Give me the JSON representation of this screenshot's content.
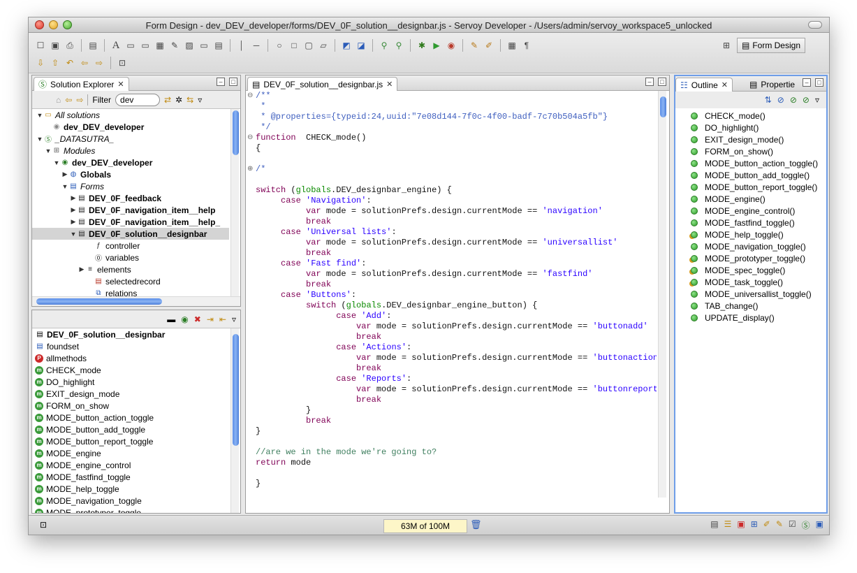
{
  "window": {
    "title": "Form Design - dev_DEV_developer/forms/DEV_0F_solution__designbar.js - Servoy Developer - /Users/admin/servoy_workspace5_unlocked"
  },
  "toolbar": {
    "perspective_label": "Form Design"
  },
  "solution_explorer": {
    "tab_label": "Solution Explorer",
    "filter_label": "Filter",
    "filter_value": "dev",
    "tree": [
      {
        "label": "All solutions",
        "depth": 0,
        "arrow": "▼",
        "style": "i",
        "icon": "folder-icon"
      },
      {
        "label": "dev_DEV_developer",
        "depth": 1,
        "arrow": "",
        "style": "b",
        "icon": "solution-grey-icon"
      },
      {
        "label": "_DATASUTRA_",
        "depth": 0,
        "arrow": "▼",
        "style": "i",
        "icon": "solution-green-icon"
      },
      {
        "label": "Modules",
        "depth": 1,
        "arrow": "▼",
        "style": "i",
        "icon": "modules-icon"
      },
      {
        "label": "dev_DEV_developer",
        "depth": 2,
        "arrow": "▼",
        "style": "b",
        "icon": "module-icon"
      },
      {
        "label": "Globals",
        "depth": 3,
        "arrow": "▶",
        "style": "b",
        "icon": "globe-icon"
      },
      {
        "label": "Forms",
        "depth": 3,
        "arrow": "▼",
        "style": "i",
        "icon": "forms-icon"
      },
      {
        "label": "DEV_0F_feedback",
        "depth": 4,
        "arrow": "▶",
        "style": "b",
        "icon": "form-icon"
      },
      {
        "label": "DEV_0F_navigation_item__help",
        "depth": 4,
        "arrow": "▶",
        "style": "b",
        "icon": "form-icon"
      },
      {
        "label": "DEV_0F_navigation_item__help_",
        "depth": 4,
        "arrow": "▶",
        "style": "b",
        "icon": "form-icon"
      },
      {
        "label": "DEV_0F_solution__designbar",
        "depth": 4,
        "arrow": "▼",
        "style": "b",
        "icon": "form-icon",
        "selected": true
      },
      {
        "label": "controller",
        "depth": 6,
        "arrow": "",
        "style": "",
        "icon": "fx-icon"
      },
      {
        "label": "variables",
        "depth": 6,
        "arrow": "",
        "style": "",
        "icon": "variables-icon"
      },
      {
        "label": "elements",
        "depth": 5,
        "arrow": "▶",
        "style": "",
        "icon": "elements-icon"
      },
      {
        "label": "selectedrecord",
        "depth": 6,
        "arrow": "",
        "style": "",
        "icon": "record-icon"
      },
      {
        "label": "relations",
        "depth": 6,
        "arrow": "",
        "style": "",
        "icon": "relations-icon"
      }
    ]
  },
  "members": {
    "header": "DEV_0F_solution__designbar",
    "items": [
      {
        "label": "foundset",
        "icon": "foundset-icon"
      },
      {
        "label": "allmethods",
        "icon": "allmethods-icon"
      },
      {
        "label": "CHECK_mode",
        "icon": "method-icon"
      },
      {
        "label": "DO_highlight",
        "icon": "method-icon"
      },
      {
        "label": "EXIT_design_mode",
        "icon": "method-icon"
      },
      {
        "label": "FORM_on_show",
        "icon": "method-icon"
      },
      {
        "label": "MODE_button_action_toggle",
        "icon": "method-icon"
      },
      {
        "label": "MODE_button_add_toggle",
        "icon": "method-icon"
      },
      {
        "label": "MODE_button_report_toggle",
        "icon": "method-icon"
      },
      {
        "label": "MODE_engine",
        "icon": "method-icon"
      },
      {
        "label": "MODE_engine_control",
        "icon": "method-icon"
      },
      {
        "label": "MODE_fastfind_toggle",
        "icon": "method-icon"
      },
      {
        "label": "MODE_help_toggle",
        "icon": "method-icon"
      },
      {
        "label": "MODE_navigation_toggle",
        "icon": "method-icon"
      },
      {
        "label": "MODE_prototyper_toggle",
        "icon": "method-icon"
      }
    ]
  },
  "editor": {
    "tab_label": "DEV_0F_solution__designbar.js",
    "lines": [
      [
        [
          "cm",
          "/**"
        ]
      ],
      [
        [
          "cm",
          " *"
        ]
      ],
      [
        [
          "cm",
          " * @properties={typeid:24,uuid:\"7e08d144-7f0c-4f00-badf-7c70b504a5fb\"}"
        ]
      ],
      [
        [
          "cm",
          " */"
        ]
      ],
      [
        [
          "kw",
          "function"
        ],
        [
          "",
          "  CHECK_mode()"
        ]
      ],
      [
        [
          "",
          "{"
        ]
      ],
      [
        [
          "",
          ""
        ]
      ],
      [
        [
          "cm",
          "/*"
        ]
      ],
      [
        [
          "",
          ""
        ]
      ],
      [
        [
          "kw",
          "switch"
        ],
        [
          "",
          " ("
        ],
        [
          "gl",
          "globals"
        ],
        [
          "",
          ".DEV_designbar_engine) {"
        ]
      ],
      [
        [
          "",
          "     "
        ],
        [
          "kw",
          "case"
        ],
        [
          "",
          " "
        ],
        [
          "str",
          "'Navigation'"
        ],
        [
          "",
          ":"
        ]
      ],
      [
        [
          "",
          "          "
        ],
        [
          "kw",
          "var"
        ],
        [
          "",
          " mode = solutionPrefs.design.currentMode == "
        ],
        [
          "str",
          "'navigation'"
        ]
      ],
      [
        [
          "",
          "          "
        ],
        [
          "kw",
          "break"
        ]
      ],
      [
        [
          "",
          "     "
        ],
        [
          "kw",
          "case"
        ],
        [
          "",
          " "
        ],
        [
          "str",
          "'Universal lists'"
        ],
        [
          "",
          ":"
        ]
      ],
      [
        [
          "",
          "          "
        ],
        [
          "kw",
          "var"
        ],
        [
          "",
          " mode = solutionPrefs.design.currentMode == "
        ],
        [
          "str",
          "'universallist'"
        ]
      ],
      [
        [
          "",
          "          "
        ],
        [
          "kw",
          "break"
        ]
      ],
      [
        [
          "",
          "     "
        ],
        [
          "kw",
          "case"
        ],
        [
          "",
          " "
        ],
        [
          "str",
          "'Fast find'"
        ],
        [
          "",
          ":"
        ]
      ],
      [
        [
          "",
          "          "
        ],
        [
          "kw",
          "var"
        ],
        [
          "",
          " mode = solutionPrefs.design.currentMode == "
        ],
        [
          "str",
          "'fastfind'"
        ]
      ],
      [
        [
          "",
          "          "
        ],
        [
          "kw",
          "break"
        ]
      ],
      [
        [
          "",
          "     "
        ],
        [
          "kw",
          "case"
        ],
        [
          "",
          " "
        ],
        [
          "str",
          "'Buttons'"
        ],
        [
          "",
          ":"
        ]
      ],
      [
        [
          "",
          "          "
        ],
        [
          "kw",
          "switch"
        ],
        [
          "",
          " ("
        ],
        [
          "gl",
          "globals"
        ],
        [
          "",
          ".DEV_designbar_engine_button) {"
        ]
      ],
      [
        [
          "",
          "                "
        ],
        [
          "kw",
          "case"
        ],
        [
          "",
          " "
        ],
        [
          "str",
          "'Add'"
        ],
        [
          "",
          ":"
        ]
      ],
      [
        [
          "",
          "                    "
        ],
        [
          "kw",
          "var"
        ],
        [
          "",
          " mode = solutionPrefs.design.currentMode == "
        ],
        [
          "str",
          "'buttonadd'"
        ]
      ],
      [
        [
          "",
          "                    "
        ],
        [
          "kw",
          "break"
        ]
      ],
      [
        [
          "",
          "                "
        ],
        [
          "kw",
          "case"
        ],
        [
          "",
          " "
        ],
        [
          "str",
          "'Actions'"
        ],
        [
          "",
          ":"
        ]
      ],
      [
        [
          "",
          "                    "
        ],
        [
          "kw",
          "var"
        ],
        [
          "",
          " mode = solutionPrefs.design.currentMode == "
        ],
        [
          "str",
          "'buttonaction'"
        ]
      ],
      [
        [
          "",
          "                    "
        ],
        [
          "kw",
          "break"
        ]
      ],
      [
        [
          "",
          "                "
        ],
        [
          "kw",
          "case"
        ],
        [
          "",
          " "
        ],
        [
          "str",
          "'Reports'"
        ],
        [
          "",
          ":"
        ]
      ],
      [
        [
          "",
          "                    "
        ],
        [
          "kw",
          "var"
        ],
        [
          "",
          " mode = solutionPrefs.design.currentMode == "
        ],
        [
          "str",
          "'buttonreport'"
        ]
      ],
      [
        [
          "",
          "                    "
        ],
        [
          "kw",
          "break"
        ]
      ],
      [
        [
          "",
          "          }"
        ]
      ],
      [
        [
          "",
          "          "
        ],
        [
          "kw",
          "break"
        ]
      ],
      [
        [
          "",
          "}"
        ]
      ],
      [
        [
          "",
          ""
        ]
      ],
      [
        [
          "cmt",
          "//are we in the mode we're going to?"
        ]
      ],
      [
        [
          "kw",
          "return"
        ],
        [
          "",
          " mode"
        ]
      ],
      [
        [
          "",
          ""
        ]
      ],
      [
        [
          "",
          "}"
        ]
      ]
    ]
  },
  "outline": {
    "tab_label": "Outline",
    "properties_tab_label": "Propertie",
    "items": [
      {
        "label": "CHECK_mode()",
        "icon": "method-dot-icon"
      },
      {
        "label": "DO_highlight()",
        "icon": "method-dot-icon"
      },
      {
        "label": "EXIT_design_mode()",
        "icon": "method-dot-icon"
      },
      {
        "label": "FORM_on_show()",
        "icon": "method-dot-icon"
      },
      {
        "label": "MODE_button_action_toggle()",
        "icon": "method-dot-icon"
      },
      {
        "label": "MODE_button_add_toggle()",
        "icon": "method-dot-icon"
      },
      {
        "label": "MODE_button_report_toggle()",
        "icon": "method-dot-icon"
      },
      {
        "label": "MODE_engine()",
        "icon": "method-dot-icon"
      },
      {
        "label": "MODE_engine_control()",
        "icon": "method-dot-icon"
      },
      {
        "label": "MODE_fastfind_toggle()",
        "icon": "method-dot-icon"
      },
      {
        "label": "MODE_help_toggle()",
        "icon": "method-lock-icon"
      },
      {
        "label": "MODE_navigation_toggle()",
        "icon": "method-dot-icon"
      },
      {
        "label": "MODE_prototyper_toggle()",
        "icon": "method-lock-icon"
      },
      {
        "label": "MODE_spec_toggle()",
        "icon": "method-lock-icon"
      },
      {
        "label": "MODE_task_toggle()",
        "icon": "method-lock-icon"
      },
      {
        "label": "MODE_universallist_toggle()",
        "icon": "method-dot-icon"
      },
      {
        "label": "TAB_change()",
        "icon": "method-dot-icon"
      },
      {
        "label": "UPDATE_display()",
        "icon": "method-dot-icon"
      }
    ]
  },
  "status": {
    "memory": "63M of 100M"
  },
  "colors": {
    "keyword": "#7f0055",
    "string": "#2a00ff",
    "doc_comment": "#3f5fbf",
    "comment": "#3f7f5f",
    "selection": "#d4d4d4",
    "method_dot": "#2e9c28"
  }
}
